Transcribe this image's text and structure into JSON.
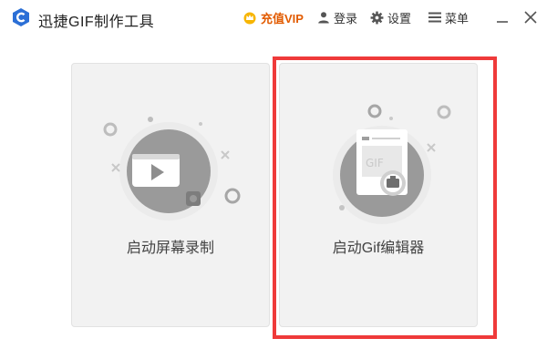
{
  "window": {
    "title": "迅捷GIF制作工具",
    "logo_icon": "app-logo-icon"
  },
  "header": {
    "vip_label": "充值VIP",
    "login_label": "登录",
    "settings_label": "设置",
    "menu_label": "菜单"
  },
  "cards": [
    {
      "label": "启动屏幕录制",
      "icon": "screen-record-icon"
    },
    {
      "label": "启动Gif编辑器",
      "icon": "gif-editor-icon"
    }
  ],
  "colors": {
    "accent": "#2b6fd6",
    "vip": "#e25b00",
    "highlight": "#ef3a3a",
    "card_bg": "#f2f2f2",
    "icon_gray": "#8c8c8c"
  }
}
